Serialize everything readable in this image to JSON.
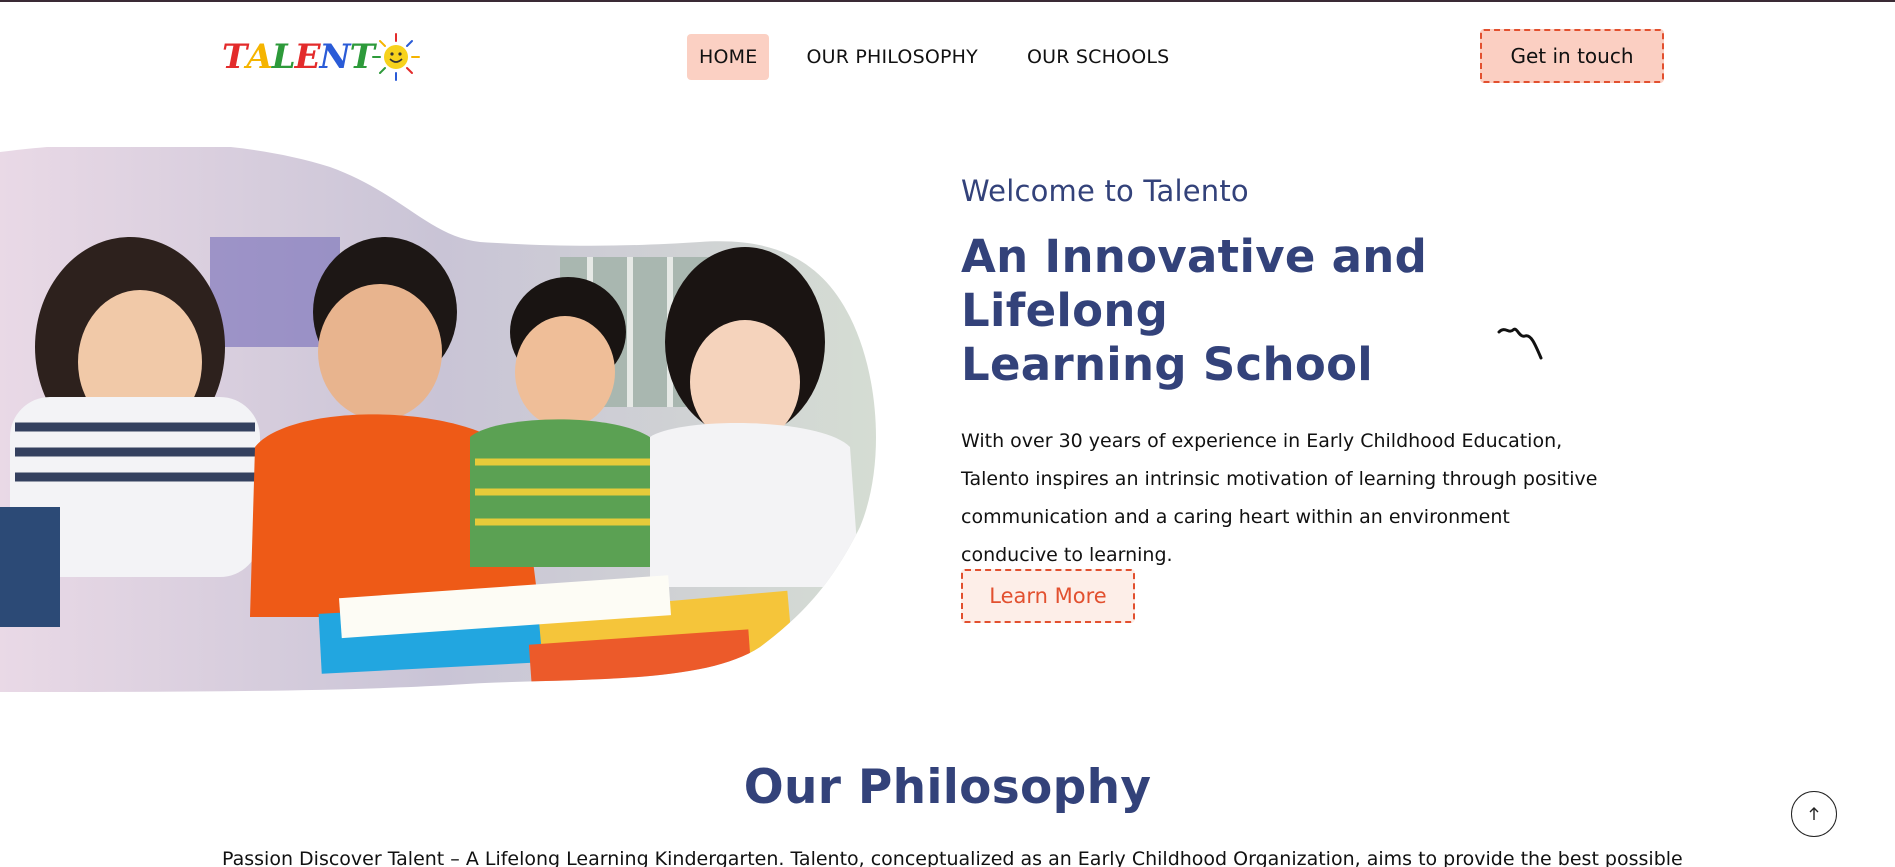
{
  "header": {
    "logo": {
      "letters": [
        {
          "char": "T",
          "color": "#e32b2b"
        },
        {
          "char": "A",
          "color": "#f5b400"
        },
        {
          "char": "L",
          "color": "#2d9a3a"
        },
        {
          "char": "E",
          "color": "#e32b2b"
        },
        {
          "char": "N",
          "color": "#2a5bd7"
        },
        {
          "char": "T",
          "color": "#2d9a3a"
        }
      ],
      "sun_color": "#f7d21c"
    },
    "nav": [
      {
        "label": "HOME",
        "active": true
      },
      {
        "label": "OUR PHILOSOPHY",
        "active": false
      },
      {
        "label": "OUR SCHOOLS",
        "active": false
      }
    ],
    "cta_label": "Get in touch"
  },
  "hero": {
    "welcome": "Welcome to Talento",
    "headline_line1": "An Innovative and Lifelong",
    "headline_line2": "Learning School",
    "intro": "With over 30 years of experience in Early Childhood Education, Talento inspires an intrinsic motivation of learning through positive communication and a caring heart within an environment conducive to learning.",
    "learn_more_label": "Learn More"
  },
  "philosophy": {
    "title": "Our Philosophy",
    "body": "Passion Discover Talent – A Lifelong Learning Kindergarten. Talento, conceptualized as an Early Childhood Organization, aims to provide the best possible"
  },
  "colors": {
    "accent": "#e2502f",
    "accent_bg": "#fbcfc2",
    "heading": "#33427a"
  }
}
